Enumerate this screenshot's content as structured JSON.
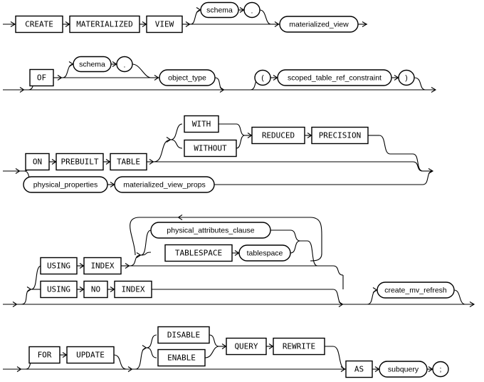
{
  "diagram": {
    "title": "create_materialized_view",
    "type": "railroad-syntax-diagram",
    "colors": {
      "line": "#000000",
      "background": "#ffffff",
      "text": "#000000"
    },
    "rows": [
      {
        "id": "row-1",
        "terminals": [
          "CREATE",
          "MATERIALIZED",
          "VIEW"
        ],
        "nonterminals": [
          "schema",
          "materialized_view"
        ],
        "punctuation": [
          "."
        ]
      },
      {
        "id": "row-2",
        "terminals": [
          "OF"
        ],
        "nonterminals": [
          "schema",
          "object_type",
          "scoped_table_ref_constraint"
        ],
        "punctuation": [
          ".",
          "(",
          ")"
        ]
      },
      {
        "id": "row-3",
        "terminals": [
          "ON",
          "PREBUILT",
          "TABLE",
          "WITH",
          "WITHOUT",
          "REDUCED",
          "PRECISION"
        ],
        "nonterminals": [
          "physical_properties",
          "materialized_view_props"
        ]
      },
      {
        "id": "row-4",
        "terminals": [
          "USING",
          "INDEX",
          "USING",
          "NO",
          "INDEX",
          "TABLESPACE"
        ],
        "nonterminals": [
          "physical_attributes_clause",
          "tablespace",
          "create_mv_refresh"
        ]
      },
      {
        "id": "row-5",
        "terminals": [
          "FOR",
          "UPDATE",
          "DISABLE",
          "ENABLE",
          "QUERY",
          "REWRITE",
          "AS"
        ],
        "nonterminals": [
          "subquery"
        ],
        "punctuation": [
          ";"
        ]
      }
    ],
    "labels": {
      "create": "CREATE",
      "materialized": "MATERIALIZED",
      "view": "VIEW",
      "schema": "schema",
      "dot": ".",
      "materialized_view": "materialized_view",
      "of": "OF",
      "schema2": "schema",
      "dot2": ".",
      "object_type": "object_type",
      "lparen": "(",
      "scoped_table_ref_constraint": "scoped_table_ref_constraint",
      "rparen": ")",
      "on": "ON",
      "prebuilt": "PREBUILT",
      "table": "TABLE",
      "with": "WITH",
      "without": "WITHOUT",
      "reduced": "REDUCED",
      "precision": "PRECISION",
      "physical_properties": "physical_properties",
      "materialized_view_props": "materialized_view_props",
      "using1": "USING",
      "index1": "INDEX",
      "using2": "USING",
      "no": "NO",
      "index2": "INDEX",
      "physical_attributes_clause": "physical_attributes_clause",
      "tablespace_kw": "TABLESPACE",
      "tablespace_nt": "tablespace",
      "create_mv_refresh": "create_mv_refresh",
      "for": "FOR",
      "update": "UPDATE",
      "disable": "DISABLE",
      "enable": "ENABLE",
      "query": "QUERY",
      "rewrite": "REWRITE",
      "as": "AS",
      "subquery": "subquery",
      "semicolon": ";"
    }
  }
}
